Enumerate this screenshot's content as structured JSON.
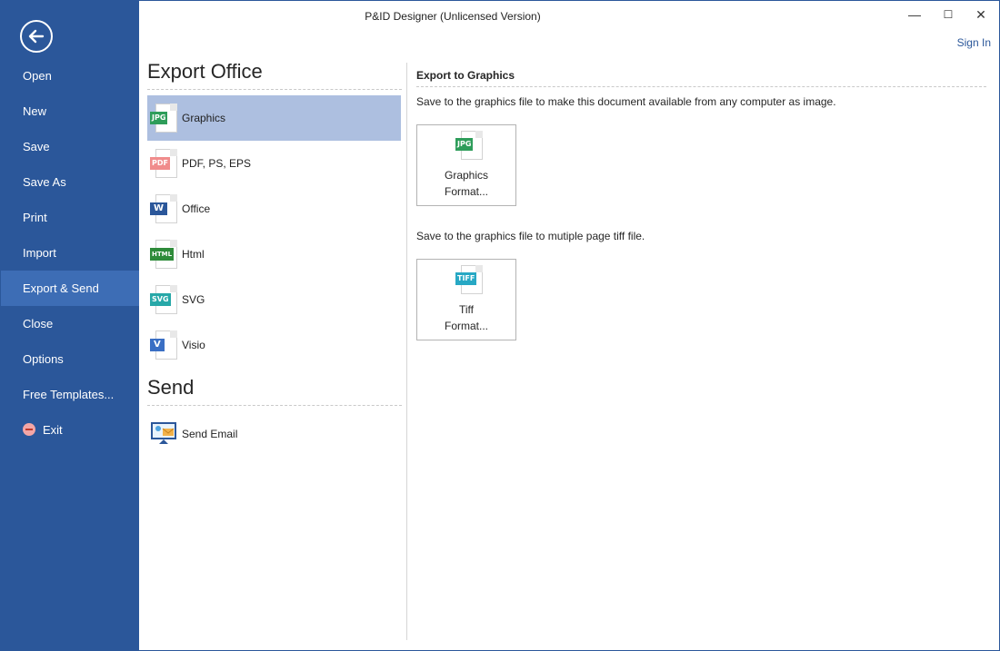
{
  "window": {
    "title": "P&ID Designer (Unlicensed Version)",
    "sign_in": "Sign In",
    "minimize_glyph": "—",
    "maximize_glyph": "☐",
    "close_glyph": "✕"
  },
  "sidebar": {
    "items": [
      {
        "label": "Open"
      },
      {
        "label": "New"
      },
      {
        "label": "Save"
      },
      {
        "label": "Save As"
      },
      {
        "label": "Print"
      },
      {
        "label": "Import"
      },
      {
        "label": "Export & Send",
        "active": true
      },
      {
        "label": "Close"
      },
      {
        "label": "Options"
      },
      {
        "label": "Free Templates..."
      },
      {
        "label": "Exit",
        "icon": "exit-icon"
      }
    ]
  },
  "export_office": {
    "title": "Export Office",
    "options": [
      {
        "label": "Graphics",
        "badge": "JPG",
        "badge_color": "#2e9d5a",
        "selected": true
      },
      {
        "label": "PDF, PS, EPS",
        "badge": "PDF",
        "badge_color": "#f08c8c"
      },
      {
        "label": "Office",
        "badge": "W",
        "badge_color": "#2b579a"
      },
      {
        "label": "Html",
        "badge": "HTML",
        "badge_color": "#2e8b3a"
      },
      {
        "label": "SVG",
        "badge": "SVG",
        "badge_color": "#27a8a8"
      },
      {
        "label": "Visio",
        "badge": "V",
        "badge_color": "#3a6fc4"
      }
    ]
  },
  "send": {
    "title": "Send",
    "options": [
      {
        "label": "Send Email",
        "icon": "email-monitor-icon"
      }
    ]
  },
  "right_pane": {
    "header": "Export to Graphics",
    "desc1": "Save to the graphics file to make this document available from any computer as image.",
    "button1": {
      "line1": "Graphics",
      "line2": "Format...",
      "badge": "JPG",
      "badge_color": "#2e9d5a"
    },
    "desc2": "Save to the graphics file to mutiple page tiff file.",
    "button2": {
      "line1": "Tiff",
      "line2": "Format...",
      "badge": "TIFF",
      "badge_color": "#27a8c4"
    }
  }
}
